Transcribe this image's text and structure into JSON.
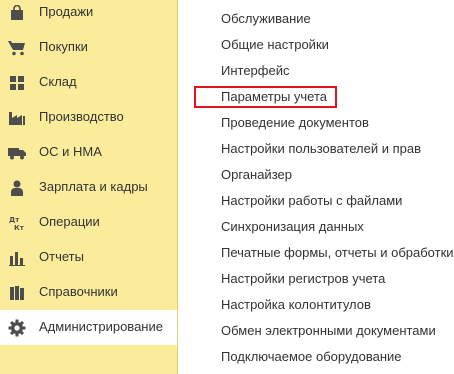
{
  "sidebar": {
    "items": [
      {
        "label": "Продажи",
        "icon": "shopping-bag-icon"
      },
      {
        "label": "Покупки",
        "icon": "shopping-cart-icon"
      },
      {
        "label": "Склад",
        "icon": "warehouse-grid-icon"
      },
      {
        "label": "Производство",
        "icon": "factory-icon"
      },
      {
        "label": "ОС и НМА",
        "icon": "truck-icon"
      },
      {
        "label": "Зарплата и кадры",
        "icon": "person-icon"
      },
      {
        "label": "Операции",
        "icon": "debit-credit-icon"
      },
      {
        "label": "Отчеты",
        "icon": "bar-chart-icon"
      },
      {
        "label": "Справочники",
        "icon": "books-icon"
      },
      {
        "label": "Администрирование",
        "icon": "gear-icon",
        "active": true
      }
    ]
  },
  "main": {
    "items": [
      "Обслуживание",
      "Общие настройки",
      "Интерфейс",
      "Параметры учета",
      "Проведение документов",
      "Настройки пользователей и прав",
      "Органайзер",
      "Настройки работы с файлами",
      "Синхронизация данных",
      "Печатные формы, отчеты и обработки",
      "Настройки регистров учета",
      "Настройка колонтитулов",
      "Обмен электронными документами",
      "Подключаемое оборудование"
    ],
    "highlighted_item": "Параметры учета"
  },
  "colors": {
    "sidebar_bg": "#fbec9c",
    "active_bg": "#ffffff",
    "text": "#333333",
    "icon": "#4d4d4d",
    "highlight_border": "#e3141c"
  }
}
